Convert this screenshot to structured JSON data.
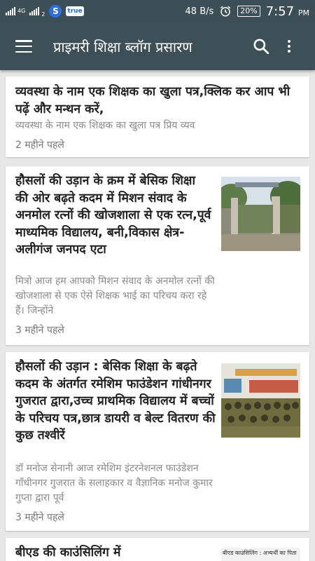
{
  "status_bar": {
    "network_label": "4G",
    "sim_label": "2",
    "truecaller_label": "true",
    "net_speed": "48 B/s",
    "battery": "20%",
    "time": "7:57",
    "ampm": "PM"
  },
  "app_bar": {
    "title": "प्राइमरी शिक्षा ब्लॉग प्रसारण"
  },
  "posts": [
    {
      "title": "व्यवस्था के नाम एक  शिक्षक का खुला पत्र,क्लिक कर आप भी पढ़ें और मन्थन करें,",
      "snippet": "व्यवस्था के नाम एक  शिक्षक का खुला पत्र प्रिय व्यव",
      "time": "2 महीने पहले"
    },
    {
      "title": "हौसलों की उड़ान के क्रम में बेसिक शिक्षा की ओर बढ़ते कदम में मिशन संवाद के अनमोल रत्नों की खोजशाला से एक रत्न,पूर्व माध्यमिक विद्यालय, बनी,विकास क्षेत्र-अलीगंज जनपद एटा",
      "snippet": "मित्रो आज हम आपको मिशन संवाद के अनमोल रत्नों की खोजशाला से एक ऐसे शिक्षक भाई का परिचय करा रहे हैं। जिन्होंने",
      "time": "3 महीने पहले"
    },
    {
      "title": "हौसलों की उड़ान : बेसिक शिक्षा के बढ़ते कदम के अंतर्गत रमेशिम फाउंडेशन गांधीनगर गुजरात द्वारा,उच्च प्राथमिक विद्यालय में बच्चों के परिचय पत्र,छात्र डायरी व बेल्ट वितरण की कुछ तश्वीरें",
      "snippet": "डॉ मनोज सेनानी आज रमेशिम इंटरनेशनल फाउंडेशन गाँधीनगर गुजरात के सलाहकार व वैज्ञानिक मनोज कुमार गुप्ता द्वारा पूर्व",
      "time": "3 महीने पहले"
    },
    {
      "title": "बीएड की काउंसिलिंग में",
      "thumb_text": "बीएड काउंसिलिंग : अभ्यर्थी का पिता"
    }
  ],
  "colors": {
    "app_bar": "#3d5058",
    "status_bar": "#3d4f56",
    "background": "#e8e8e8"
  }
}
